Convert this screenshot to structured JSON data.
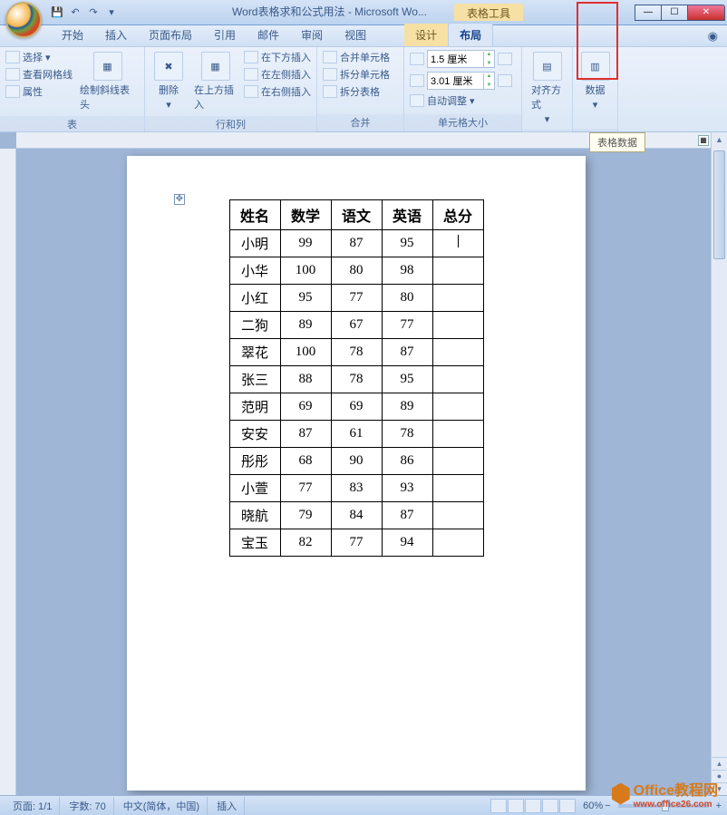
{
  "title": {
    "doc": "Word表格求和公式用法 - Microsoft Wo...",
    "context": "表格工具"
  },
  "tabs": {
    "items": [
      "开始",
      "插入",
      "页面布局",
      "引用",
      "邮件",
      "审阅",
      "视图"
    ],
    "context": [
      "设计",
      "布局"
    ],
    "active": "布局"
  },
  "ribbon": {
    "group_table": {
      "title": "表",
      "select": "选择",
      "gridlines": "查看网格线",
      "properties": "属性",
      "draw": "绘制斜线表头"
    },
    "group_rowscols": {
      "title": "行和列",
      "delete": "删除",
      "insert_above": "在上方插入",
      "insert_below": "在下方插入",
      "insert_left": "在左侧插入",
      "insert_right": "在右侧插入"
    },
    "group_merge": {
      "title": "合并",
      "merge": "合并单元格",
      "split": "拆分单元格",
      "split_table": "拆分表格"
    },
    "group_cellsize": {
      "title": "单元格大小",
      "height": "1.5 厘米",
      "width": "3.01 厘米",
      "autofit": "自动调整"
    },
    "group_align": {
      "title": "对齐方式"
    },
    "group_data": {
      "title": "数据"
    }
  },
  "tooltip": "表格数据",
  "chart_data": {
    "type": "table",
    "headers": [
      "姓名",
      "数学",
      "语文",
      "英语",
      "总分"
    ],
    "rows": [
      [
        "小明",
        "99",
        "87",
        "95",
        ""
      ],
      [
        "小华",
        "100",
        "80",
        "98",
        ""
      ],
      [
        "小红",
        "95",
        "77",
        "80",
        ""
      ],
      [
        "二狗",
        "89",
        "67",
        "77",
        ""
      ],
      [
        "翠花",
        "100",
        "78",
        "87",
        ""
      ],
      [
        "张三",
        "88",
        "78",
        "95",
        ""
      ],
      [
        "范明",
        "69",
        "69",
        "89",
        ""
      ],
      [
        "安安",
        "87",
        "61",
        "78",
        ""
      ],
      [
        "彤彤",
        "68",
        "90",
        "86",
        ""
      ],
      [
        "小萱",
        "77",
        "83",
        "93",
        ""
      ],
      [
        "晓航",
        "79",
        "84",
        "87",
        ""
      ],
      [
        "宝玉",
        "82",
        "77",
        "94",
        ""
      ]
    ]
  },
  "statusbar": {
    "page": "页面: 1/1",
    "words": "字数: 70",
    "lang": "中文(简体，中国)",
    "mode": "插入",
    "zoom": "60%"
  },
  "watermark": {
    "line1": "Office教程网",
    "line2": "www.office26.com"
  }
}
